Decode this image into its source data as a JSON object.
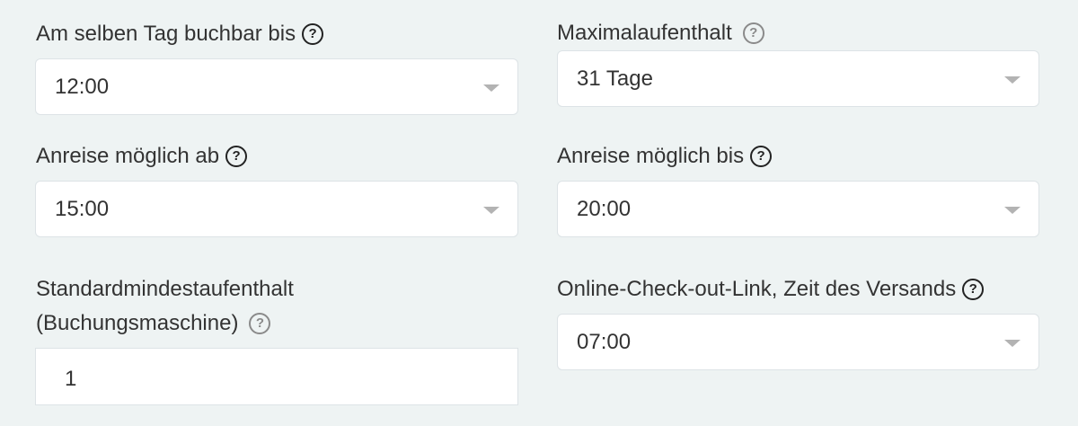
{
  "fields": {
    "same_day_booking": {
      "label": "Am selben Tag buchbar bis",
      "value": "12:00",
      "help_icon": "question-circle-icon"
    },
    "max_stay": {
      "label": "Maximalaufenthalt",
      "value": "31 Tage",
      "help_icon": "question-circle-icon"
    },
    "arrival_from": {
      "label": "Anreise möglich ab",
      "value": "15:00",
      "help_icon": "question-circle-icon"
    },
    "arrival_until": {
      "label": "Anreise möglich bis",
      "value": "20:00",
      "help_icon": "question-circle-icon"
    },
    "default_min_stay": {
      "label_line1": "Standardmindestaufenthalt",
      "label_line2": "(Buchungsmaschine)",
      "value": "1",
      "help_icon": "question-circle-icon"
    },
    "checkout_link_time": {
      "label": "Online-Check-out-Link, Zeit des Versands",
      "value": "07:00",
      "help_icon": "question-circle-icon"
    }
  },
  "colors": {
    "background": "#eef3f3",
    "text": "#333333",
    "field_border": "#dde3e6",
    "caret": "#b3b3b3"
  }
}
